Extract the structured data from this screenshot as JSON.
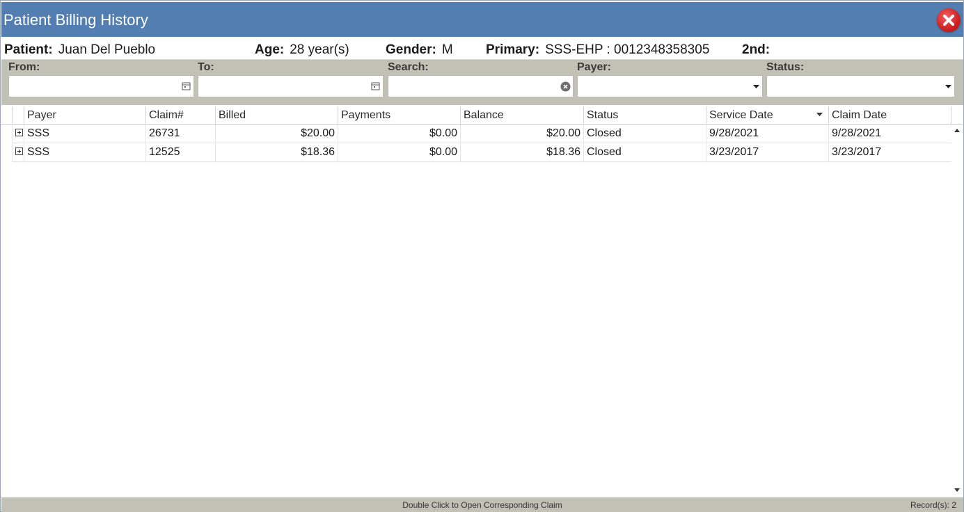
{
  "window": {
    "title": "Patient Billing History"
  },
  "patient": {
    "patient_label": "Patient:",
    "patient_value": "Juan Del Pueblo",
    "age_label": "Age:",
    "age_value": "28 year(s)",
    "gender_label": "Gender:",
    "gender_value": "M",
    "primary_label": "Primary:",
    "primary_value": "SSS-EHP : 0012348358305",
    "secondary_label": "2nd:",
    "secondary_value": ""
  },
  "filters": {
    "from_label": "From:",
    "from_value": "",
    "to_label": "To:",
    "to_value": "",
    "search_label": "Search:",
    "search_value": "",
    "payer_label": "Payer:",
    "payer_value": "",
    "status_label": "Status:",
    "status_value": ""
  },
  "grid": {
    "columns": [
      "Payer",
      "Claim#",
      "Billed",
      "Payments",
      "Balance",
      "Status",
      "Service Date",
      "Claim Date"
    ],
    "rows": [
      {
        "payer": "SSS",
        "claim": "26731",
        "billed": "$20.00",
        "payments": "$0.00",
        "balance": "$20.00",
        "status": "Closed",
        "service_date": "9/28/2021",
        "claim_date": "9/28/2021"
      },
      {
        "payer": "SSS",
        "claim": "12525",
        "billed": "$18.36",
        "payments": "$0.00",
        "balance": "$18.36",
        "status": "Closed",
        "service_date": "3/23/2017",
        "claim_date": "3/23/2017"
      }
    ],
    "sorted_column": "Service Date"
  },
  "statusbar": {
    "hint": "Double Click to Open Corresponding Claim",
    "records": "Record(s): 2"
  },
  "icons": {
    "close": "close-icon",
    "calendar": "calendar-icon",
    "clear": "clear-search-icon",
    "dropdown": "chevron-down-icon",
    "expand": "expand-row-icon",
    "sort": "sort-descending-icon"
  },
  "colors": {
    "titlebar": "#537eb1",
    "filter_bar": "#c2c1b5",
    "close_button": "#d02020"
  }
}
